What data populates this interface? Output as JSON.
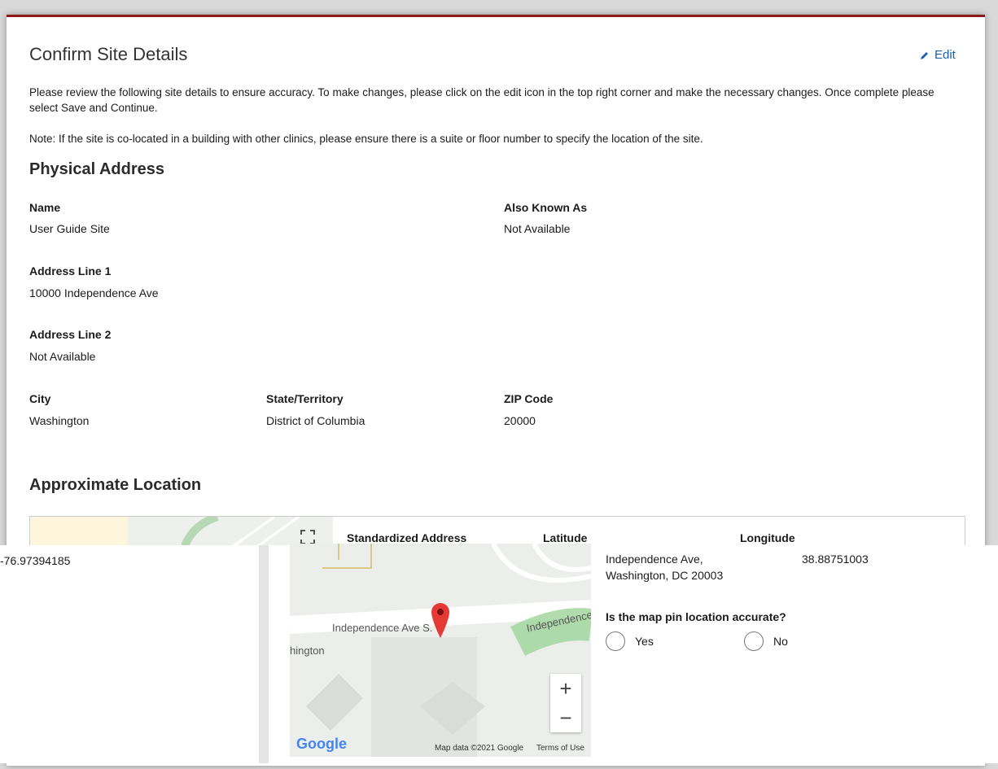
{
  "header": {
    "title": "Confirm Site Details",
    "edit_label": "Edit"
  },
  "intro": {
    "p1": "Please review the following site details to ensure accuracy. To make changes, please click on the edit icon in the top right corner and make the necessary changes. Once complete please select Save and Continue.",
    "note": "Note: If the site is co-located in a building with other clinics, please ensure there is a suite or floor number to specify the location of the site."
  },
  "physical": {
    "heading": "Physical Address",
    "name_label": "Name",
    "name_value": "User Guide Site",
    "aka_label": "Also Known As",
    "aka_value": "Not Available",
    "addr1_label": "Address Line 1",
    "addr1_value": "10000 Independence Ave",
    "addr2_label": "Address Line 2",
    "addr2_value": "Not Available",
    "city_label": "City",
    "city_value": "Washington",
    "state_label": "State/Territory",
    "state_value": "District of Columbia",
    "zip_label": "ZIP Code",
    "zip_value": "20000"
  },
  "location": {
    "heading": "Approximate Location",
    "std_label": "Standardized Address",
    "lat_label": "Latitude",
    "lon_label": "Longitude",
    "longitude_value": "-76.97394185",
    "std_address_line1": "Independence Ave,",
    "std_address_line2": "Washington, DC 20003",
    "latitude_value": "38.88751003",
    "question": "Is the map pin location accurate?",
    "yes": "Yes",
    "no": "No"
  },
  "map": {
    "street1": "Independence Ave S.",
    "street2": "Independence",
    "city_fragment": "hington",
    "google": "Google",
    "attribution": "Map data ©2021 Google",
    "terms": "Terms of Use",
    "zoom_in": "+",
    "zoom_out": "−",
    "fullscreen_icon": "fullscreen-icon",
    "pin_color": "#e53935"
  },
  "colors": {
    "accent": "#1a5fb4",
    "topbar": "#8b1a1a"
  }
}
